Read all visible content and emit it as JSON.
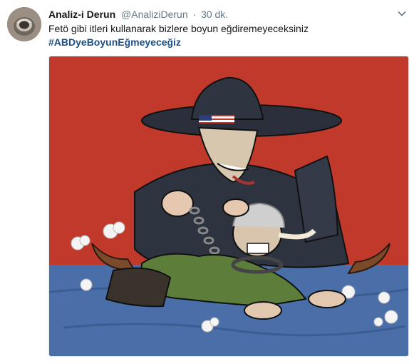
{
  "tweet": {
    "display_name": "Analiz-i Derun",
    "handle": "@AnaliziDerun",
    "separator": "·",
    "time": "30 dk.",
    "text": "Fetö gibi itleri kullanarak bizlere boyun eğdiremeyeceksiniz",
    "hashtag": "#ABDyeBoyunEğmeyeceğiz"
  },
  "icons": {
    "avatar": "avatar-ring-image",
    "menu": "chevron-down-icon"
  },
  "colors": {
    "name": "#14171a",
    "meta": "#657786",
    "hashtag": "#1b4f8a",
    "wall": "#c0392b",
    "floor": "#4a6ea8"
  }
}
